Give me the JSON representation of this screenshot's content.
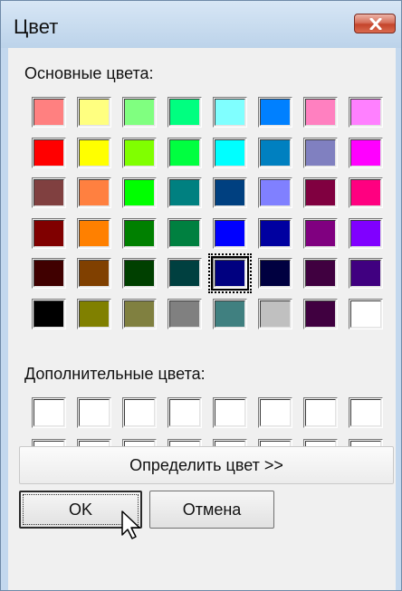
{
  "dialog": {
    "title": "Цвет",
    "basic_colors_label": "Основные цвета:",
    "custom_colors_label": "Дополнительные цвета:",
    "define_button_label": "Определить цвет >>",
    "ok_label": "OK",
    "cancel_label": "Отмена",
    "close_icon": "close-icon"
  },
  "basic_colors": [
    [
      "#ff8080",
      "#ffff80",
      "#80ff80",
      "#00ff80",
      "#80ffff",
      "#0080ff",
      "#ff80c0",
      "#ff80ff"
    ],
    [
      "#ff0000",
      "#ffff00",
      "#80ff00",
      "#00ff40",
      "#00ffff",
      "#0080c0",
      "#8080c0",
      "#ff00ff"
    ],
    [
      "#804040",
      "#ff8040",
      "#00ff00",
      "#008080",
      "#004080",
      "#8080ff",
      "#800040",
      "#ff0080"
    ],
    [
      "#800000",
      "#ff8000",
      "#008000",
      "#008040",
      "#0000ff",
      "#0000a0",
      "#800080",
      "#8000ff"
    ],
    [
      "#400000",
      "#804000",
      "#004000",
      "#004040",
      "#000080",
      "#000040",
      "#400040",
      "#400080"
    ],
    [
      "#000000",
      "#808000",
      "#808040",
      "#808080",
      "#408080",
      "#c0c0c0",
      "#400040",
      "#ffffff"
    ]
  ],
  "selected_basic_color": {
    "row": 4,
    "col": 4,
    "hex": "#000080"
  },
  "custom_colors": [
    [
      "#ffffff",
      "#ffffff",
      "#ffffff",
      "#ffffff",
      "#ffffff",
      "#ffffff",
      "#ffffff",
      "#ffffff"
    ],
    [
      "#ffffff",
      "#ffffff",
      "#ffffff",
      "#ffffff",
      "#ffffff",
      "#ffffff",
      "#ffffff",
      "#ffffff"
    ]
  ]
}
